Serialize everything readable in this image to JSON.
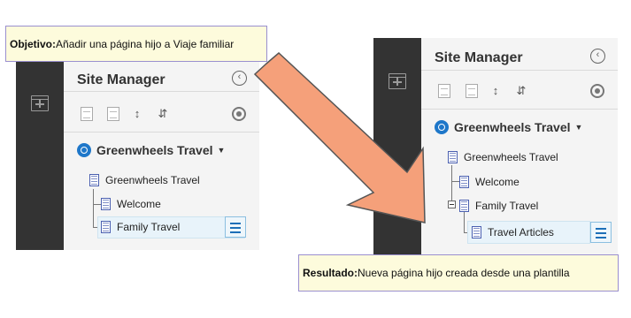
{
  "objective": {
    "label": "Objetivo:",
    "text": " Añadir una página hijo a Viaje familiar"
  },
  "result": {
    "label": "Resultado:",
    "text": " Nueva página hijo creada desde una plantilla"
  },
  "before": {
    "title": "Site Manager",
    "site_name": "Greenwheels Travel",
    "tree": {
      "root": "Greenwheels Travel",
      "children": [
        "Welcome",
        "Family Travel"
      ]
    }
  },
  "after": {
    "title": "Site Manager",
    "site_name": "Greenwheels Travel",
    "tree": {
      "root": "Greenwheels Travel",
      "children": [
        "Welcome",
        "Family Travel"
      ],
      "grandchild": "Travel Articles"
    }
  },
  "colors": {
    "arrow": "#f5a07a",
    "highlight": "#e8f3fa",
    "dark_rail": "#333333",
    "callout_bg": "#fdfbdc"
  },
  "icons": [
    "add-page-icon",
    "back-icon",
    "pages-icon",
    "page-icon",
    "move-up-down-icon",
    "collapse-icon",
    "settings-icon",
    "site-logo-icon",
    "dropdown-caret-icon",
    "menu-icon"
  ]
}
